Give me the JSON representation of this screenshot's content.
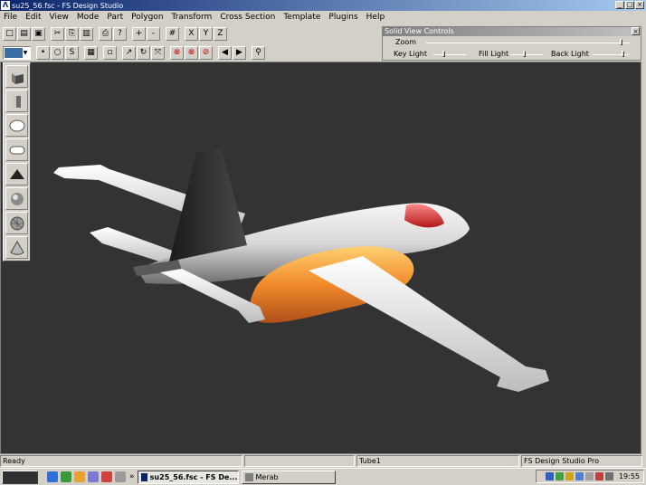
{
  "window": {
    "title": "su25_56.fsc - FS Design Studio",
    "app_icon_glyph": "Λ",
    "buttons": [
      "_",
      "□",
      "×"
    ]
  },
  "menu": [
    "File",
    "Edit",
    "View",
    "Mode",
    "Part",
    "Polygon",
    "Transform",
    "Cross Section",
    "Template",
    "Plugins",
    "Help"
  ],
  "toolbar1": {
    "icons": [
      "new-icon",
      "open-icon",
      "save-icon",
      "cut-icon",
      "copy-icon",
      "paste-icon",
      "print-icon",
      "help-icon",
      "zoom-in-icon",
      "zoom-out-icon",
      "grid-icon",
      "x-axis-icon",
      "y-axis-icon",
      "z-axis-icon"
    ],
    "glyphs": [
      "□",
      "▤",
      "▣",
      "✂",
      "⎘",
      "▥",
      "⎙",
      "?",
      "+",
      "-",
      "#",
      "X",
      "Y",
      "Z"
    ]
  },
  "toolbar2": {
    "icons": [
      "point-icon",
      "circle-icon",
      "curve-icon",
      "select-box-icon",
      "template-icon",
      "arrow-icon",
      "rotate-icon",
      "scale-icon",
      "no-select-icon",
      "no-move-icon",
      "no-edit-icon",
      "prev-icon",
      "next-icon",
      "find-icon"
    ],
    "glyphs": [
      "•",
      "○",
      "S",
      "▦",
      "▫",
      "↗",
      "↻",
      "⤧",
      "⊗",
      "⊗",
      "⊘",
      "◀",
      "▶",
      "⚲"
    ]
  },
  "solid_view_controls": {
    "title": "Solid View Controls",
    "close": "×",
    "zoom_label": "Zoom",
    "key_light_label": "Key Light",
    "fill_light_label": "Fill Light",
    "back_light_label": "Back Light",
    "zoom_level": 0.97,
    "key_light_level": 0.3,
    "fill_light_level": 0.45,
    "back_light_level": 0.9
  },
  "shapes_palette": [
    "cube-icon",
    "cylinder-icon",
    "ellipse-icon",
    "capsule-icon",
    "pyramid-icon",
    "sphere-icon",
    "geosphere-icon",
    "cone-icon"
  ],
  "colors": {
    "viewport_bg": "#333333",
    "titlebar_start": "#0a246a",
    "fuselage": "#e8e8e8",
    "fin": "#2a2a2a",
    "nose_cap": "#c83030",
    "engine_nacelle": "#e86c1c",
    "intake": "#f0c040"
  },
  "status": {
    "left": "Ready",
    "part": "Tube1",
    "product": "FS Design Studio Pro"
  },
  "taskbar": {
    "chevron": "»",
    "items": [
      {
        "label": "su25_56.fsc - FS De...",
        "active": true
      },
      {
        "label": "Merab",
        "active": false
      }
    ],
    "clock": "19:55"
  }
}
